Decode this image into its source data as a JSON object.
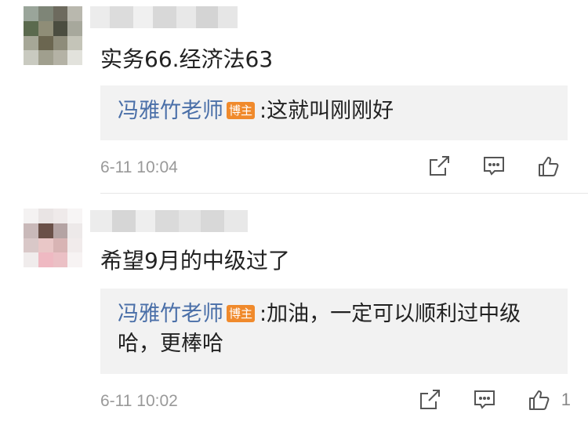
{
  "comments": [
    {
      "text": "实务66.经济法63",
      "reply": {
        "author": "冯雅竹老师",
        "badge": "博主",
        "text": ":这就叫刚刚好"
      },
      "time": "6-11 10:04",
      "likes": ""
    },
    {
      "text": "希望9月的中级过了",
      "reply": {
        "author": "冯雅竹老师",
        "badge": "博主",
        "text": ":加油，一定可以顺利过中级",
        "text_line2": "哈，更棒哈"
      },
      "time": "6-11 10:02",
      "likes": "1"
    }
  ],
  "icons": {
    "share": "share-icon",
    "comment": "comment-icon",
    "like": "thumbs-up-icon"
  },
  "colors": {
    "author": "#4a6fa8",
    "badge": "#f08a2c",
    "reply_bg": "#f2f2f2",
    "meta": "#999999"
  }
}
